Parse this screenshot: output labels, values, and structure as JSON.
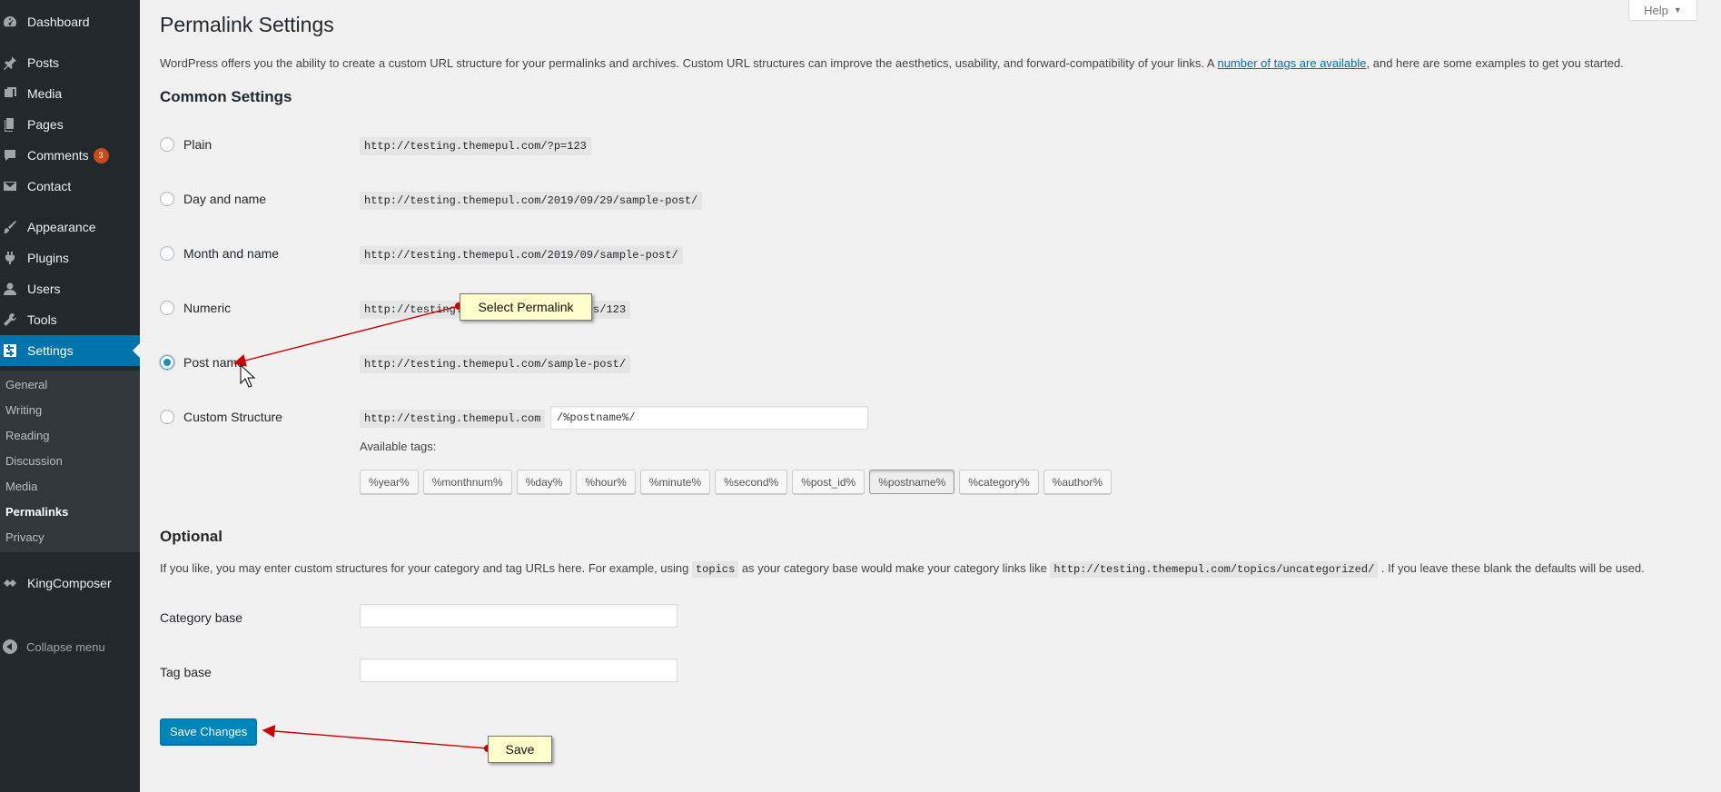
{
  "sidebar": {
    "items": [
      {
        "label": "Dashboard",
        "icon": "dashboard-icon"
      },
      {
        "label": "Posts",
        "icon": "pin-icon"
      },
      {
        "label": "Media",
        "icon": "media-icon"
      },
      {
        "label": "Pages",
        "icon": "pages-icon"
      },
      {
        "label": "Comments",
        "icon": "comment-icon",
        "badge": "3"
      },
      {
        "label": "Contact",
        "icon": "envelope-icon"
      },
      {
        "label": "Appearance",
        "icon": "paintbrush-icon"
      },
      {
        "label": "Plugins",
        "icon": "plug-icon"
      },
      {
        "label": "Users",
        "icon": "user-icon"
      },
      {
        "label": "Tools",
        "icon": "wrench-icon"
      },
      {
        "label": "Settings",
        "icon": "settings-icon",
        "active": true
      },
      {
        "label": "KingComposer",
        "icon": "kingcomposer-icon"
      }
    ],
    "submenu": [
      "General",
      "Writing",
      "Reading",
      "Discussion",
      "Media",
      "Permalinks",
      "Privacy"
    ],
    "submenu_current": "Permalinks",
    "collapse_label": "Collapse menu",
    "active_color": "#0073aa",
    "badge_color": "#ca4a1f"
  },
  "help_tab": {
    "label": "Help",
    "arrow": "▼"
  },
  "page": {
    "title": "Permalink Settings",
    "intro_before": "WordPress offers you the ability to create a custom URL structure for your permalinks and archives. Custom URL structures can improve the aesthetics, usability, and forward-compatibility of your links. A ",
    "intro_link": "number of tags are available",
    "intro_after": ", and here are some examples to get you started."
  },
  "common": {
    "title": "Common Settings",
    "options": [
      {
        "label": "Plain",
        "example": "http://testing.themepul.com/?p=123",
        "checked": false
      },
      {
        "label": "Day and name",
        "example": "http://testing.themepul.com/2019/09/29/sample-post/",
        "checked": false
      },
      {
        "label": "Month and name",
        "example": "http://testing.themepul.com/2019/09/sample-post/",
        "checked": false
      },
      {
        "label": "Numeric",
        "example": "http://testing.themepul.com/archives/123",
        "checked": false
      },
      {
        "label": "Post name",
        "example": "http://testing.themepul.com/sample-post/",
        "checked": true
      }
    ],
    "custom": {
      "label": "Custom Structure",
      "prefix": "http://testing.themepul.com",
      "value": "/%postname%/",
      "available_label": "Available tags:",
      "tags": [
        "%year%",
        "%monthnum%",
        "%day%",
        "%hour%",
        "%minute%",
        "%second%",
        "%post_id%",
        "%postname%",
        "%category%",
        "%author%"
      ],
      "active_tag": "%postname%"
    }
  },
  "optional": {
    "title": "Optional",
    "text_1": "If you like, you may enter custom structures for your category and tag URLs here. For example, using ",
    "code_1": "topics",
    "text_2": " as your category base would make your category links like ",
    "code_2": "http://testing.themepul.com/topics/uncategorized/",
    "text_3": " . If you leave these blank the defaults will be used.",
    "category_label": "Category base",
    "category_value": "",
    "tag_label": "Tag base",
    "tag_value": ""
  },
  "save_button": {
    "label": "Save Changes",
    "color": "#0085ba"
  },
  "annotations": {
    "select_callout": "Select Permalink",
    "save_callout": "Save",
    "arrow_color": "#cc0000"
  }
}
